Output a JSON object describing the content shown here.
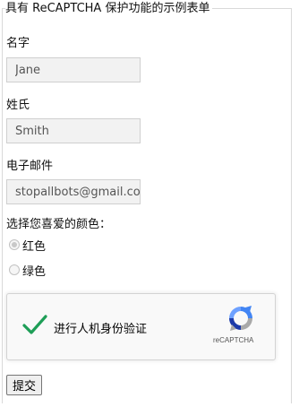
{
  "form": {
    "legend": "具有 ReCAPTCHA 保护功能的示例表单",
    "first_name": {
      "label": "名字",
      "value": "Jane"
    },
    "last_name": {
      "label": "姓氏",
      "value": "Smith"
    },
    "email": {
      "label": "电子邮件",
      "value": "stopallbots@gmail.com"
    },
    "color": {
      "label": "选择您喜爱的颜色：",
      "options": [
        {
          "label": "红色",
          "checked": true
        },
        {
          "label": "绿色",
          "checked": false
        }
      ]
    },
    "captcha": {
      "text": "进行人机身份验证",
      "brand": "reCAPTCHA",
      "verified": true,
      "check_color": "#1e9e57"
    },
    "submit_label": "提交"
  }
}
